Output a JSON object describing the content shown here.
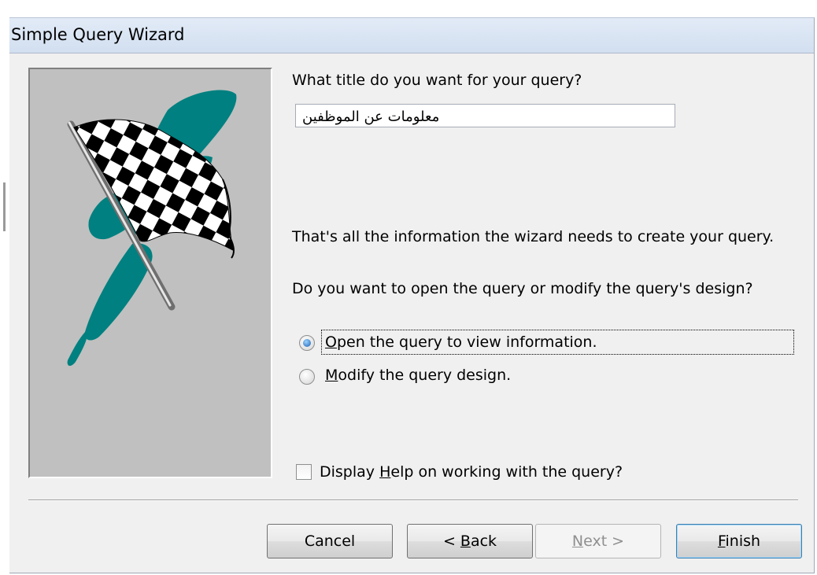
{
  "window": {
    "title": "Simple Query Wizard"
  },
  "prompt_title": "What title do you want for your query?",
  "query_title_value": "معلومات عن الموظفين",
  "info_text": "That's all the information the wizard needs to create your query.",
  "question_text": "Do you want to open the query or modify the query's design?",
  "options": [
    {
      "pre": "",
      "mnemonic": "O",
      "post": "pen the query to view information.",
      "selected": true
    },
    {
      "pre": "",
      "mnemonic": "M",
      "post": "odify the query design.",
      "selected": false
    }
  ],
  "help_checkbox": {
    "pre": "Display ",
    "mnemonic": "H",
    "post": "elp on working with the query?",
    "checked": false
  },
  "buttons": {
    "cancel": "Cancel",
    "back": {
      "pre": "< ",
      "mnemonic": "B",
      "post": "ack"
    },
    "next": {
      "pre": "",
      "mnemonic": "N",
      "post": "ext >",
      "enabled": false
    },
    "finish": {
      "pre": "",
      "mnemonic": "F",
      "post": "inish"
    }
  },
  "colors": {
    "flag_stroke": "#008080",
    "image_bg": "#c0c0c0",
    "dialog_bg": "#f0f0f0",
    "title_bar": "#dbe6f4"
  },
  "icons": [
    "checkered-flag-image",
    "radio-selected-icon",
    "radio-unselected-icon",
    "checkbox-icon"
  ]
}
